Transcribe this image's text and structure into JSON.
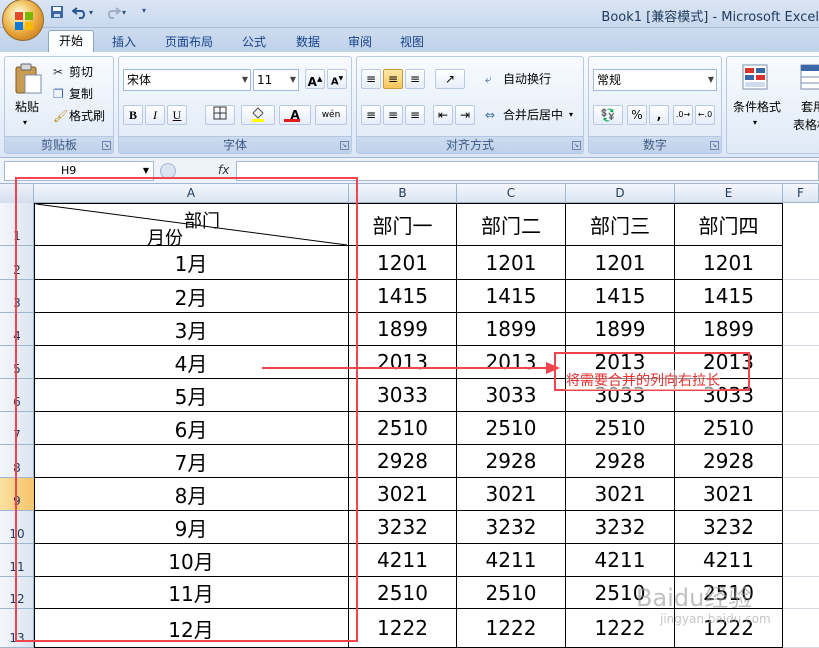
{
  "window": {
    "title": "Book1  [兼容模式] - Microsoft Excel"
  },
  "qat": {
    "save_icon": "save-icon",
    "undo_icon": "undo-icon",
    "redo_icon": "redo-icon"
  },
  "tabs": [
    "开始",
    "插入",
    "页面布局",
    "公式",
    "数据",
    "审阅",
    "视图"
  ],
  "ribbon": {
    "clipboard": {
      "label": "剪贴板",
      "paste": "粘贴",
      "cut": "剪切",
      "copy": "复制",
      "format_painter": "格式刷"
    },
    "font": {
      "label": "字体",
      "font_name": "宋体",
      "font_size": "11",
      "bold": "B",
      "italic": "I",
      "underline": "U",
      "grow": "A",
      "shrink": "A",
      "font_color_letter": "A",
      "phonetic": "wén"
    },
    "alignment": {
      "label": "对齐方式",
      "wrap": "自动换行",
      "merge": "合并后居中"
    },
    "number": {
      "label": "数字",
      "format": "常规",
      "percent": "%",
      "comma": ","
    },
    "styles": {
      "conditional": "条件格式",
      "table_line1": "套用",
      "table_line2": "表格格"
    }
  },
  "formula_bar": {
    "name_box": "H9",
    "fx": "fx"
  },
  "columns": [
    "A",
    "B",
    "C",
    "D",
    "E",
    "F"
  ],
  "rows": [
    "1",
    "2",
    "3",
    "4",
    "5",
    "6",
    "7",
    "8",
    "9",
    "10",
    "11",
    "12",
    "13"
  ],
  "selected_row": "9",
  "header": {
    "diag_top": "部门",
    "diag_bottom": "月份",
    "departments": [
      "部门一",
      "部门二",
      "部门三",
      "部门四"
    ]
  },
  "data_rows": [
    {
      "month": "1月",
      "values": [
        "1201",
        "1201",
        "1201",
        "1201"
      ]
    },
    {
      "month": "2月",
      "values": [
        "1415",
        "1415",
        "1415",
        "1415"
      ]
    },
    {
      "month": "3月",
      "values": [
        "1899",
        "1899",
        "1899",
        "1899"
      ]
    },
    {
      "month": "4月",
      "values": [
        "2013",
        "2013",
        "2013",
        "2013"
      ]
    },
    {
      "month": "5月",
      "values": [
        "3033",
        "3033",
        "3033",
        "3033"
      ]
    },
    {
      "month": "6月",
      "values": [
        "2510",
        "2510",
        "2510",
        "2510"
      ]
    },
    {
      "month": "7月",
      "values": [
        "2928",
        "2928",
        "2928",
        "2928"
      ]
    },
    {
      "month": "8月",
      "values": [
        "3021",
        "3021",
        "3021",
        "3021"
      ]
    },
    {
      "month": "9月",
      "values": [
        "3232",
        "3232",
        "3232",
        "3232"
      ]
    },
    {
      "month": "10月",
      "values": [
        "4211",
        "4211",
        "4211",
        "4211"
      ]
    },
    {
      "month": "11月",
      "values": [
        "2510",
        "2510",
        "2510",
        "2510"
      ]
    },
    {
      "month": "12月",
      "values": [
        "1222",
        "1222",
        "1222",
        "1222"
      ]
    }
  ],
  "annotation": {
    "note": "将需要合并的列向右拉长",
    "color": "#f0454d"
  },
  "watermark": {
    "text": "Baidu经验",
    "sub": "jingyan.baidu.com"
  }
}
